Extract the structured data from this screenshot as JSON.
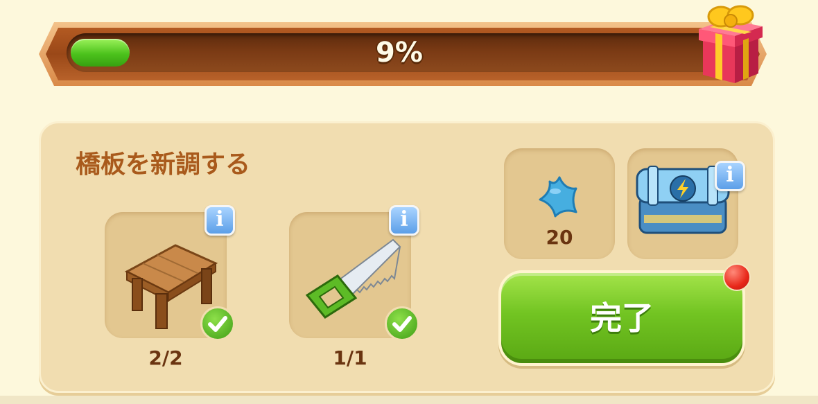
{
  "progress": {
    "percent_label": "9%",
    "fraction": 0.09
  },
  "task": {
    "title": "橋板を新調する"
  },
  "requirements": [
    {
      "item": "wooden-table",
      "count": "2/2",
      "completed": true
    },
    {
      "item": "hand-saw",
      "count": "1/1",
      "completed": true
    }
  ],
  "rewards": [
    {
      "item": "blue-star",
      "amount": "20"
    },
    {
      "item": "energy-chest"
    }
  ],
  "action": {
    "complete_label": "完了",
    "has_notification": true
  },
  "icons": {
    "gift": "gift-box-icon",
    "info": "info-icon",
    "check": "checkmark-icon"
  },
  "colors": {
    "progress_fill": "#4cc21c",
    "title": "#a95a1c",
    "button": "#72c422",
    "notification": "#e8281a"
  }
}
